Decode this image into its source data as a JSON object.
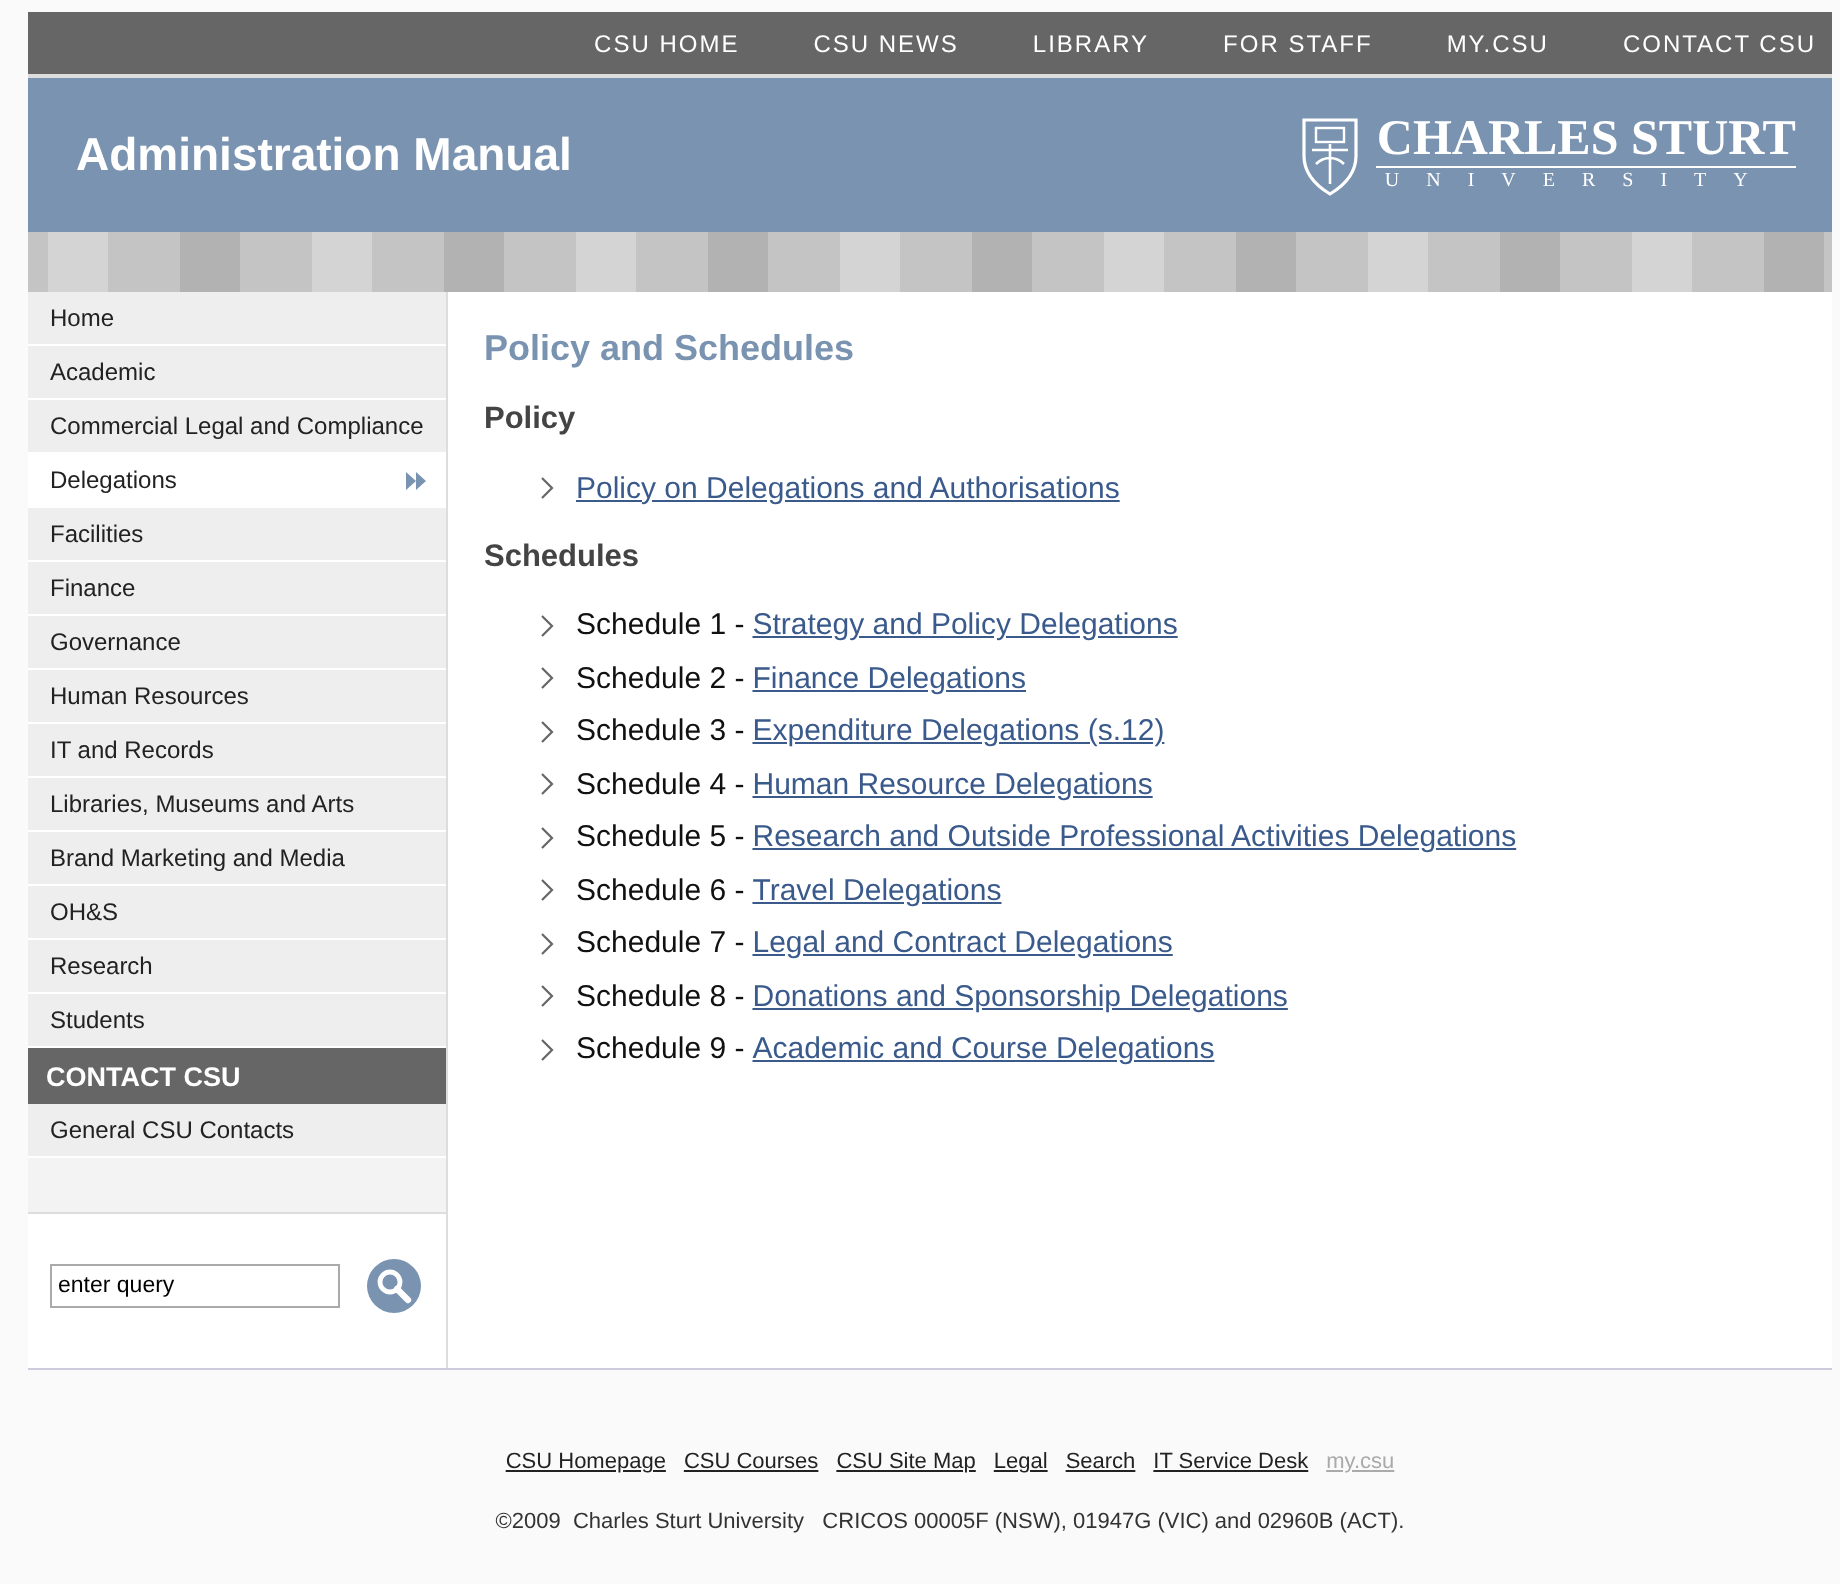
{
  "top_nav": [
    {
      "label": "CSU HOME"
    },
    {
      "label": "CSU NEWS"
    },
    {
      "label": "LIBRARY"
    },
    {
      "label": "FOR STAFF"
    },
    {
      "label": "MY.CSU"
    },
    {
      "label": "CONTACT CSU"
    }
  ],
  "banner": {
    "title": "Administration Manual",
    "logo_name": "CHARLES STURT",
    "logo_sub": "UNIVERSITY"
  },
  "sidebar": {
    "items": [
      {
        "label": "Home",
        "selected": false
      },
      {
        "label": "Academic",
        "selected": false
      },
      {
        "label": "Commercial Legal and Compliance",
        "selected": false
      },
      {
        "label": "Delegations",
        "selected": true
      },
      {
        "label": "Facilities",
        "selected": false
      },
      {
        "label": "Finance",
        "selected": false
      },
      {
        "label": "Governance",
        "selected": false
      },
      {
        "label": "Human Resources",
        "selected": false
      },
      {
        "label": "IT and Records",
        "selected": false
      },
      {
        "label": "Libraries, Museums and Arts",
        "selected": false
      },
      {
        "label": "Brand Marketing and Media",
        "selected": false
      },
      {
        "label": "OH&S",
        "selected": false
      },
      {
        "label": "Research",
        "selected": false
      },
      {
        "label": "Students",
        "selected": false
      }
    ],
    "contact_heading": "CONTACT CSU",
    "contact_items": [
      {
        "label": "General CSU Contacts",
        "selected": false
      }
    ],
    "search": {
      "value": "enter query"
    }
  },
  "content": {
    "title": "Policy and Schedules",
    "sections": [
      {
        "heading": "Policy",
        "items": [
          {
            "link": "Policy on Delegations and Authorisations"
          }
        ]
      },
      {
        "heading": "Schedules",
        "items": [
          {
            "prefix": "Schedule 1 -",
            "link": "Strategy and Policy Delegations"
          },
          {
            "prefix": "Schedule 2 -",
            "link": "Finance Delegations"
          },
          {
            "prefix": "Schedule 3 -",
            "link": "Expenditure Delegations (s.12)"
          },
          {
            "prefix": "Schedule 4 -",
            "link": "Human Resource Delegations"
          },
          {
            "prefix": "Schedule 5 -",
            "link": "Research and Outside Professional Activities Delegations"
          },
          {
            "prefix": "Schedule 6 -",
            "link": "Travel Delegations"
          },
          {
            "prefix": "Schedule 7 -",
            "link": "Legal and Contract Delegations"
          },
          {
            "prefix": "Schedule 8 -",
            "link": "Donations and Sponsorship Delegations"
          },
          {
            "prefix": "Schedule 9 -",
            "link": "Academic and Course Delegations"
          }
        ]
      }
    ]
  },
  "footer": {
    "links": [
      {
        "label": "CSU Homepage",
        "muted": false
      },
      {
        "label": "CSU Courses",
        "muted": false
      },
      {
        "label": "CSU Site Map",
        "muted": false
      },
      {
        "label": "Legal",
        "muted": false
      },
      {
        "label": "Search",
        "muted": false
      },
      {
        "label": "IT Service Desk",
        "muted": false
      },
      {
        "label": "my.csu",
        "muted": true
      }
    ],
    "copyright": "©2009  Charles Sturt University   CRICOS 00005F (NSW), 01947G (VIC) and 02960B (ACT)."
  }
}
